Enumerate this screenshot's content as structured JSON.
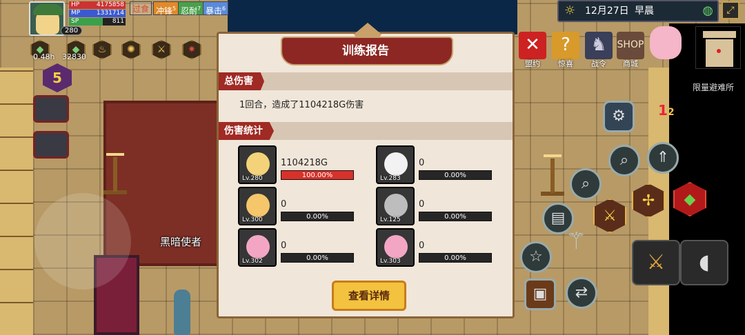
{
  "hud": {
    "level": "280",
    "hp": {
      "label": "HP",
      "value": "4175858"
    },
    "mp": {
      "label": "MP",
      "value": "1331714"
    },
    "sp": {
      "label": "SP",
      "value": "811"
    },
    "status_tags": [
      {
        "label": "过食",
        "color": "#d84a3a"
      },
      {
        "label": "冲锋",
        "color": "#e08a2a",
        "count": "5"
      },
      {
        "label": "忍耐",
        "color": "#4aa04a",
        "count": "7"
      },
      {
        "label": "暴击",
        "color": "#5a8ad8",
        "count": "6"
      }
    ],
    "timer_left": "0.48h",
    "counter": "32830",
    "wave": "5"
  },
  "topbar": {
    "date": "12月27日",
    "time_of_day": "早晨"
  },
  "menu": [
    {
      "label": "盟约",
      "icon": "covenant-x-icon"
    },
    {
      "label": "惊喜",
      "icon": "surprise-gift-icon"
    },
    {
      "label": "战令",
      "icon": "battle-pass-icon"
    },
    {
      "label": "商城",
      "icon": "shop-icon",
      "badge": "SHOP"
    }
  ],
  "map": {
    "location": "限量避难所"
  },
  "npc": {
    "name": "黑暗使者"
  },
  "side_badge": {
    "value": "1",
    "sub": "2"
  },
  "modal": {
    "title": "训练报告",
    "total_section": "总伤害",
    "total_text": "1回合，造成了1104218G伤害",
    "stats_section": "伤害统计",
    "heroes": [
      {
        "level": "Lv.280",
        "damage": "1104218G",
        "percent": "100.00%",
        "fill": 1.0,
        "color": "#f3d27a"
      },
      {
        "level": "Lv.283",
        "damage": "0",
        "percent": "0.00%",
        "fill": 0,
        "color": "#f2f2f2"
      },
      {
        "level": "Lv.300",
        "damage": "0",
        "percent": "0.00%",
        "fill": 0,
        "color": "#f5c66a"
      },
      {
        "level": "Lv.125",
        "damage": "0",
        "percent": "0.00%",
        "fill": 0,
        "color": "#bdbdbd"
      },
      {
        "level": "Lv.302",
        "damage": "0",
        "percent": "0.00%",
        "fill": 0,
        "color": "#f2a6c4"
      },
      {
        "level": "Lv.303",
        "damage": "0",
        "percent": "0.00%",
        "fill": 0,
        "color": "#f2a6c4"
      }
    ],
    "detail_button": "查看详情"
  }
}
